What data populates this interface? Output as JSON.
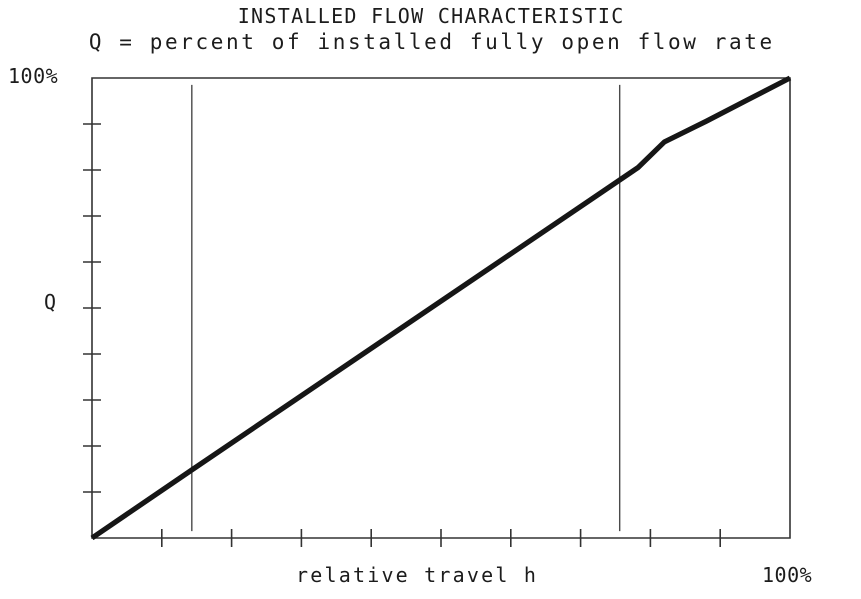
{
  "titles": {
    "main": "INSTALLED FLOW CHARACTERISTIC",
    "sub": "Q = percent of installed fully open flow rate"
  },
  "labels": {
    "y_top": "100%",
    "y_axis": "Q",
    "x_axis": "relative travel h",
    "x_max": "100%"
  },
  "colors": {
    "curve": "#161616",
    "axis": "#333333",
    "reference_line": "#4a4a4a",
    "background": "#ffffff",
    "text": "#1c1c1c"
  },
  "chart_data": {
    "type": "line",
    "title": "INSTALLED FLOW CHARACTERISTIC",
    "subtitle": "Q = percent of installed fully open flow rate",
    "xlabel": "relative travel h",
    "ylabel": "Q",
    "xlim": [
      0,
      100
    ],
    "ylim": [
      0,
      100
    ],
    "x_tick_labels": [
      "",
      "",
      "",
      "",
      "",
      "",
      "",
      "",
      "",
      "",
      "100%"
    ],
    "y_tick_labels": [
      "",
      "",
      "",
      "",
      "",
      "",
      "",
      "",
      "",
      "",
      "100%"
    ],
    "x_ticks": [
      0,
      10,
      20,
      30,
      40,
      50,
      60,
      70,
      80,
      90,
      100
    ],
    "y_ticks": [
      0,
      10,
      20,
      30,
      40,
      50,
      60,
      70,
      80,
      90,
      100
    ],
    "grid": false,
    "legend": "none",
    "series": [
      {
        "name": "installed flow characteristic",
        "x": [
          0,
          14.3,
          28.6,
          42.9,
          57.2,
          71.5,
          78.2,
          82.0,
          88.0,
          94.0,
          100
        ],
        "y": [
          0,
          14.8,
          29.5,
          44.2,
          58.9,
          73.6,
          80.5,
          86.1,
          90.6,
          95.3,
          100
        ]
      }
    ],
    "annotations": [
      {
        "name": "left-reference-line",
        "type": "vertical-line",
        "x": 14.3,
        "y_from": 1.5,
        "y_to": 98.5
      },
      {
        "name": "right-reference-line",
        "type": "vertical-line",
        "x": 75.6,
        "y_from": 1.5,
        "y_to": 98.5
      }
    ]
  }
}
